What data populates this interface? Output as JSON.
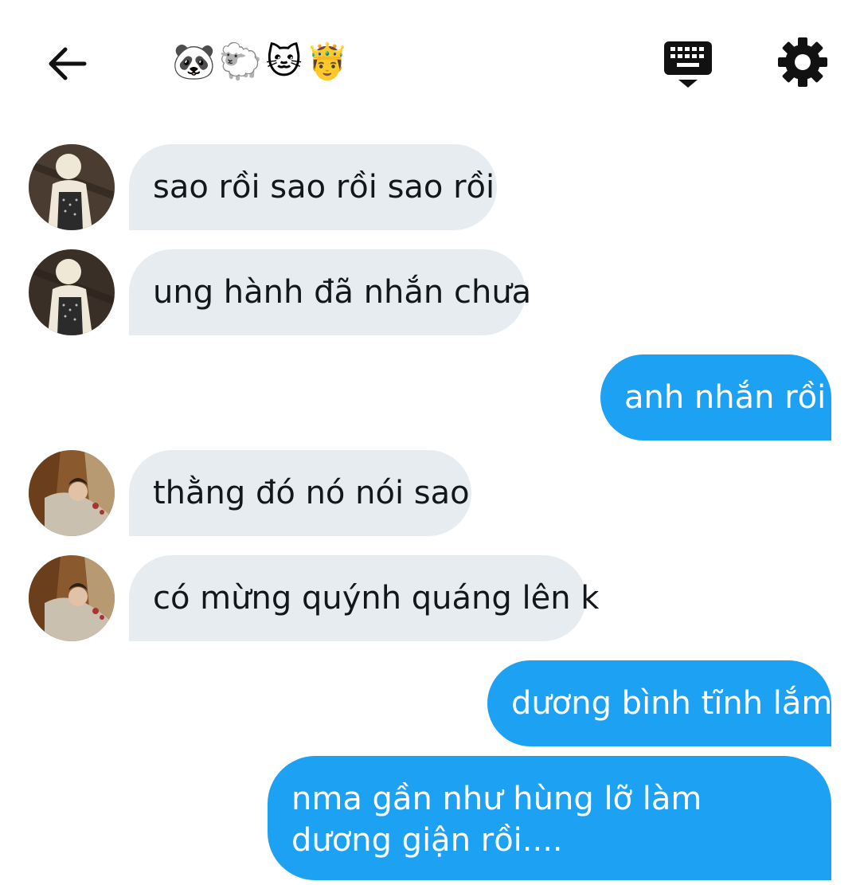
{
  "header": {
    "title_emojis": [
      "🐼",
      "🐑",
      "🐱",
      "🤴"
    ]
  },
  "messages": [
    {
      "side": "in",
      "avatar": "avatar-blonde-boy",
      "text": "sao rồi sao rồi sao rồi"
    },
    {
      "side": "in",
      "avatar": "avatar-blonde-boy",
      "text": "ung hành đã nhắn chưa"
    },
    {
      "side": "out",
      "text": "anh nhắn rồi"
    },
    {
      "side": "in",
      "avatar": "avatar-dark-hair-boy",
      "text": "thằng đó nó nói sao"
    },
    {
      "side": "in",
      "avatar": "avatar-dark-hair-boy",
      "text": "có mừng quýnh quáng lên k"
    },
    {
      "side": "out",
      "text": "dương bình tĩnh lắm"
    },
    {
      "side": "out",
      "text": "nma gần như hùng lỡ làm dương giận rồi...."
    }
  ],
  "colors": {
    "incoming_bubble": "#e6ecf0",
    "outgoing_bubble": "#1da1f2",
    "incoming_text": "#14171a",
    "outgoing_text": "#ffffff"
  },
  "icons": {
    "back": "arrow-left-icon",
    "keyboard": "keyboard-icon",
    "settings": "gear-icon"
  }
}
